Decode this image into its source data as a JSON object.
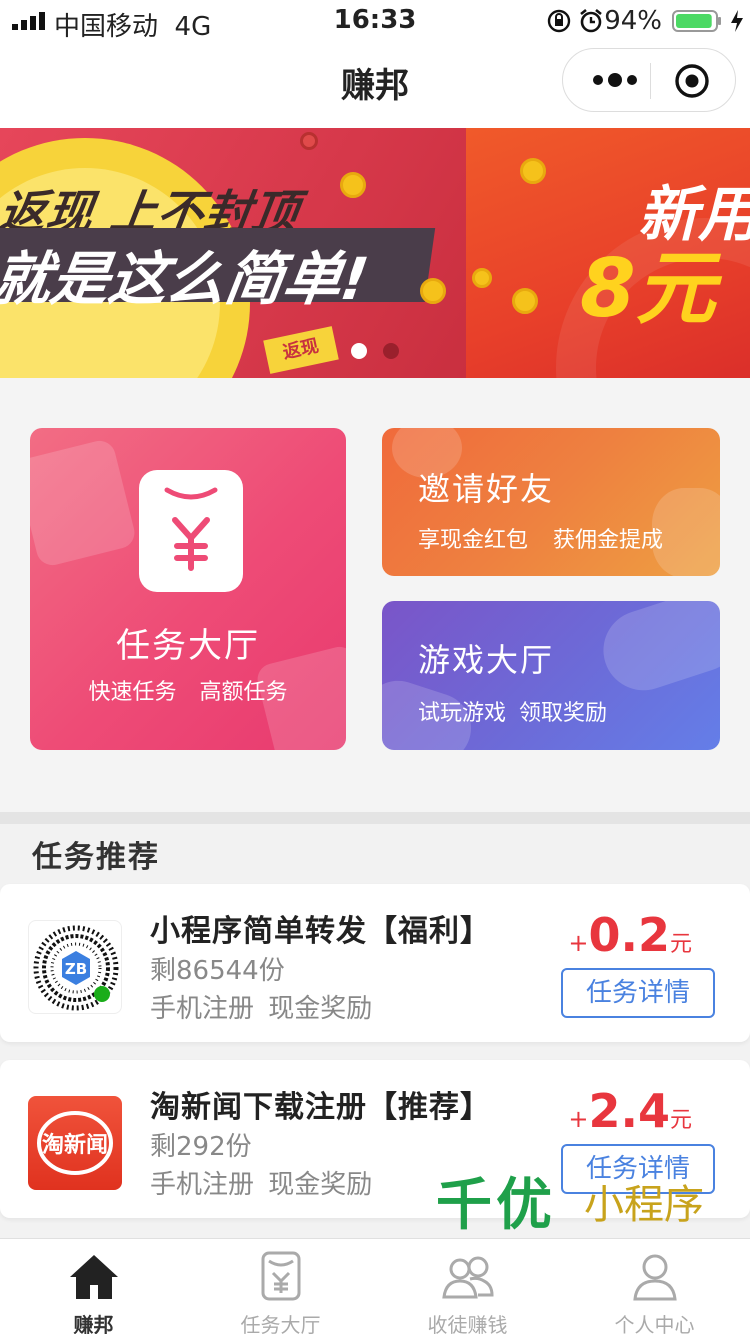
{
  "status_bar": {
    "carrier": "中国移动",
    "network": "4G",
    "time": "16:33",
    "battery": "94%",
    "battery_level": 0.94,
    "battery_color": "#4cd964"
  },
  "nav": {
    "title": "赚邦"
  },
  "banner": {
    "slide1": {
      "line1": "返现 上不封顶",
      "line2": "就是这么简单!",
      "tag": "返现"
    },
    "slide2": {
      "line1": "新用",
      "line2": "8元"
    },
    "indicator": {
      "count": 2,
      "active": 0
    }
  },
  "features": {
    "task_hall": {
      "title": "任务大厅",
      "subtitle": "快速任务 高额任务",
      "icon": "yen-envelope-icon"
    },
    "invite": {
      "title": "邀请好友",
      "subtitle": "享现金红包 获佣金提成"
    },
    "game_hall": {
      "title": "游戏大厅",
      "subtitle": "试玩游戏 领取奖励"
    }
  },
  "recommend": {
    "title": "任务推荐",
    "items": [
      {
        "title": "小程序简单转发【福利】",
        "remaining": "剩86544份",
        "tags": "手机注册 现金奖励",
        "reward_sign": "+",
        "reward_amount": "0.2",
        "reward_unit": "元",
        "button": "任务详情",
        "thumb": "qr-code-icon"
      },
      {
        "title": "淘新闻下载注册【推荐】",
        "remaining": "剩292份",
        "tags": "手机注册 现金奖励",
        "reward_sign": "+",
        "reward_amount": "2.4",
        "reward_unit": "元",
        "button": "任务详情",
        "thumb": "taoxinwen-logo",
        "thumb_text": "淘新闻"
      }
    ]
  },
  "watermark": {
    "big": "千优",
    "small": "小程序"
  },
  "tabbar": {
    "items": [
      {
        "label": "赚邦",
        "icon": "home-icon",
        "active": true
      },
      {
        "label": "任务大厅",
        "icon": "yen-envelope-icon",
        "active": false
      },
      {
        "label": "收徒赚钱",
        "icon": "users-icon",
        "active": false
      },
      {
        "label": "个人中心",
        "icon": "user-icon",
        "active": false
      }
    ]
  },
  "colors": {
    "accent_red": "#e8363e",
    "link_blue": "#4a82e0",
    "task_card": "#ee4b76",
    "invite_card": "#ee8140",
    "game_card": "#6c6bd8"
  }
}
